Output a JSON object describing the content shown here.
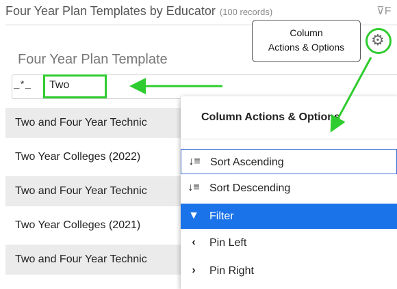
{
  "header": {
    "title": "Four Year Plan Templates by Educator",
    "record_count": "(100 records)",
    "filter_label": "F"
  },
  "column": {
    "title": "Four Year Plan Template",
    "filter_mode": "_*_",
    "filter_value": "Two"
  },
  "rows": [
    "Two and Four Year Technic",
    "Two Year Colleges (2022)",
    "Two and Four Year Technic",
    "Two Year Colleges (2021)",
    "Two and Four Year Technic"
  ],
  "tooltip": {
    "line1": "Column",
    "line2": "Actions & Options"
  },
  "menu": {
    "title": "Column Actions & Options",
    "items": [
      {
        "label": "Sort Ascending",
        "icon": "sort-ascending-icon"
      },
      {
        "label": "Sort Descending",
        "icon": "sort-descending-icon"
      },
      {
        "label": "Filter",
        "icon": "filter-icon"
      },
      {
        "label": "Pin Left",
        "icon": "chevron-left-icon"
      },
      {
        "label": "Pin Right",
        "icon": "chevron-right-icon"
      }
    ]
  },
  "colors": {
    "annotation_green": "#2ecc2e",
    "active_blue": "#1a73e8",
    "row_stripe": "#ebebeb"
  }
}
